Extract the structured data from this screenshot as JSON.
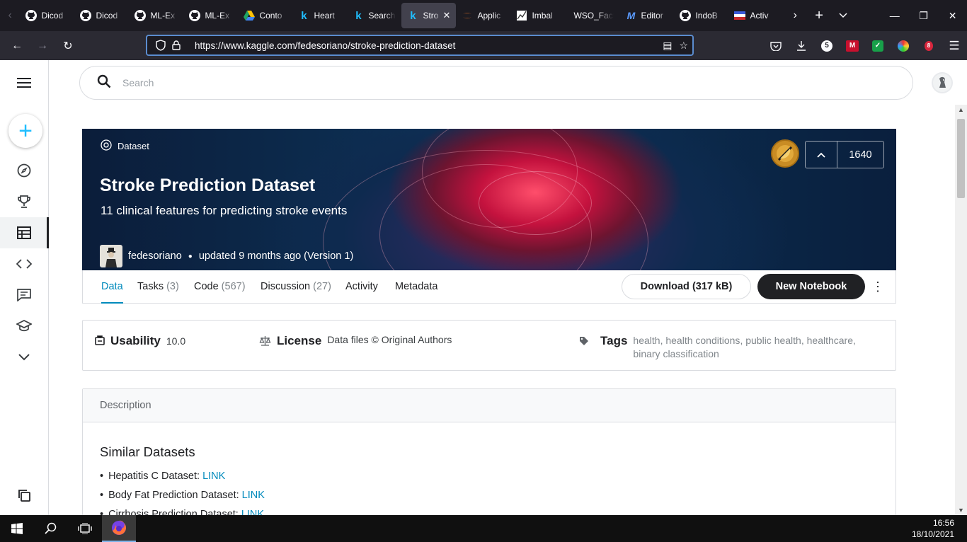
{
  "browser": {
    "tabs": [
      {
        "title": "Dicod",
        "icon": "github-icon",
        "active": false
      },
      {
        "title": "Dicod",
        "icon": "github-icon",
        "active": false
      },
      {
        "title": "ML-Ex",
        "icon": "github-icon",
        "active": false
      },
      {
        "title": "ML-Ex",
        "icon": "github-icon",
        "active": false
      },
      {
        "title": "Conto",
        "icon": "google-drive-icon",
        "active": false
      },
      {
        "title": "Heart",
        "icon": "kaggle-icon",
        "active": false
      },
      {
        "title": "Search",
        "icon": "kaggle-icon",
        "active": false
      },
      {
        "title": "Stro",
        "icon": "kaggle-icon",
        "active": true
      },
      {
        "title": "Applic",
        "icon": "jupyter-icon",
        "active": false
      },
      {
        "title": "Imbal",
        "icon": "chart-icon",
        "active": false
      },
      {
        "title": "WSO_Fact",
        "icon": "none",
        "active": false
      },
      {
        "title": "Editor",
        "icon": "medium-icon",
        "active": false
      },
      {
        "title": "IndoB",
        "icon": "github-icon",
        "active": false
      },
      {
        "title": "Activ",
        "icon": "flag-icon",
        "active": false
      }
    ],
    "url": "https://www.kaggle.com/fedesoriano/stroke-prediction-dataset",
    "extension_badge": "5"
  },
  "search": {
    "placeholder": "Search"
  },
  "dataset": {
    "kind": "Dataset",
    "title": "Stroke Prediction Dataset",
    "subtitle": "11 clinical features for predicting stroke events",
    "owner": "fedesoriano",
    "updated": "updated 9 months ago (Version 1)",
    "votes": "1640"
  },
  "tabs": [
    {
      "label": "Data",
      "count": ""
    },
    {
      "label": "Tasks",
      "count": "(3)"
    },
    {
      "label": "Code",
      "count": "(567)"
    },
    {
      "label": "Discussion",
      "count": "(27)"
    },
    {
      "label": "Activity",
      "count": ""
    },
    {
      "label": "Metadata",
      "count": ""
    }
  ],
  "actions": {
    "download": "Download (317 kB)",
    "new_notebook": "New Notebook"
  },
  "meta": {
    "usability_label": "Usability",
    "usability_value": "10.0",
    "license_label": "License",
    "license_value": "Data files © Original Authors",
    "tags_label": "Tags",
    "tags": [
      "health",
      "health conditions",
      "public health",
      "healthcare",
      "binary classification"
    ]
  },
  "description": {
    "header": "Description",
    "heading": "Similar Datasets",
    "items": [
      {
        "text": "Hepatitis C Dataset: ",
        "link": "LINK"
      },
      {
        "text": "Body Fat Prediction Dataset: ",
        "link": "LINK"
      },
      {
        "text": "Cirrhosis Prediction Dataset: ",
        "link": "LINK"
      }
    ]
  },
  "taskbar": {
    "time": "16:56",
    "date": "18/10/2021"
  },
  "colors": {
    "accent": "#008abc",
    "kaggle_blue": "#20beff",
    "chrome_dark": "#1c1b22"
  }
}
